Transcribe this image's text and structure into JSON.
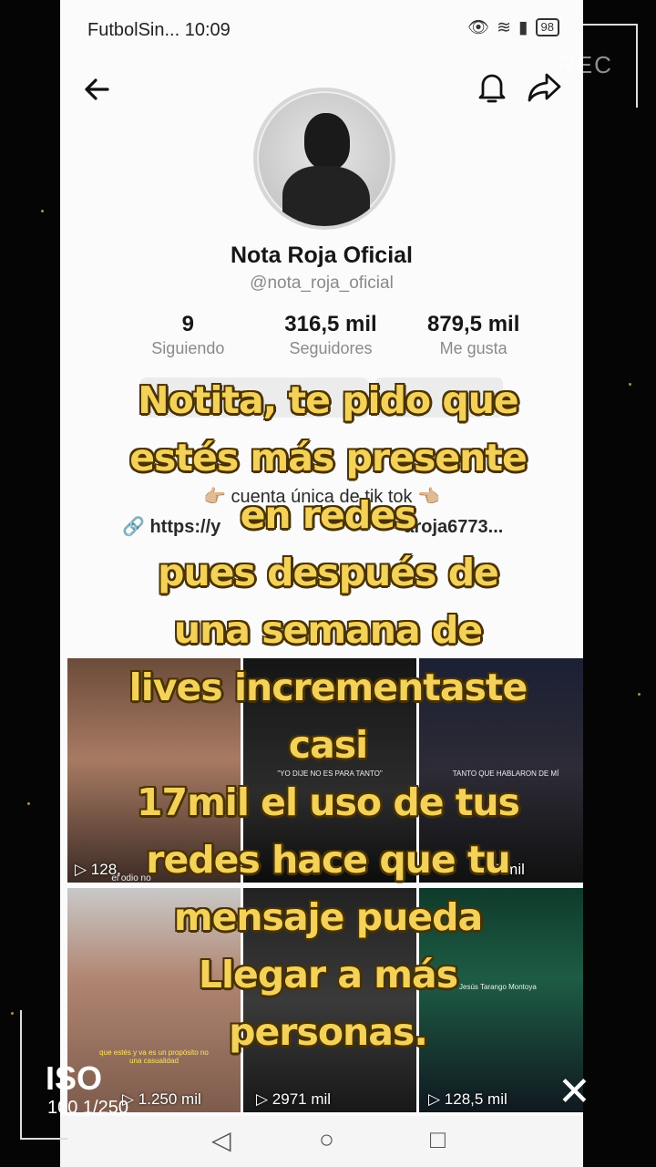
{
  "status_bar": {
    "left_text": "FutbolSin... 10:09",
    "battery": "98"
  },
  "profile": {
    "name": "Nota Roja Oficial",
    "handle": "@nota_roja_oficial",
    "stats": [
      {
        "value": "9",
        "label": "Siguiendo"
      },
      {
        "value": "316,5 mil",
        "label": "Seguidores"
      },
      {
        "value": "879,5 mil",
        "label": "Me gusta"
      }
    ],
    "bio_line": "👉🏼 cuenta única de tik tok 👈🏼",
    "link_start": "https://y",
    "link_end": "aroja6773..."
  },
  "videos": [
    {
      "views": "128,",
      "caption": "el odio no"
    },
    {
      "views": "",
      "caption": "\"YO DIJE NO ES PARA TANTO\""
    },
    {
      "views": "8 mil",
      "caption": "TANTO QUE HABLARON DE MÍ"
    },
    {
      "views": "1.250 mil",
      "caption": "que estés y va es un propósito no una casualidad"
    },
    {
      "views": "2971 mil",
      "caption": ""
    },
    {
      "views": "128,5 mil",
      "caption": "Jesús Tarango Montoya"
    }
  ],
  "overlay_text": [
    "Notita, te pido que",
    "estés más presente",
    "en redes",
    "pues después de",
    "una semana de",
    "lives incrementaste",
    "casi",
    "17mil el uso de tus",
    "redes hace que tu",
    "mensaje pueda",
    "Llegar a más",
    "personas."
  ],
  "camera_overlay": {
    "rec": "REC",
    "iso_label": "ISO",
    "iso_value": "100 1/250"
  },
  "colors": {
    "overlay_text": "#f4d259",
    "overlay_outline": "#4a3200",
    "phone_bg": "#fbfbfb",
    "outer_bg": "#050505"
  }
}
